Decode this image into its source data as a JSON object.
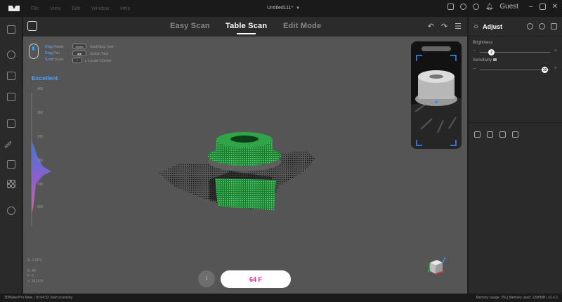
{
  "titlebar": {
    "menu": [
      "File",
      "View",
      "Edit",
      "Window",
      "Help"
    ],
    "document_title": "Untitled111*",
    "user": "Guest"
  },
  "modes": {
    "easy_scan": "Easy Scan",
    "table_scan": "Table Scan",
    "edit_mode": "Edit Mode",
    "active": "Table Scan"
  },
  "hints": {
    "rows": [
      {
        "key": "Drag",
        "value": "Rotate"
      },
      {
        "key": "Drag",
        "value": "Pan"
      },
      {
        "key": "Scroll",
        "value": "Scale"
      }
    ],
    "right": [
      {
        "key": "Space",
        "value": "Start/Stop Task"
      },
      {
        "key": "",
        "value": "Switch Task"
      },
      {
        "key": "",
        "value": "Locate 1Center"
      }
    ]
  },
  "quality": {
    "label": "Excellent",
    "ticks": [
      "400",
      "360",
      "320",
      "280",
      "240",
      "200"
    ]
  },
  "stats": {
    "fps": "11.2 FPS",
    "lines": [
      "D: 84",
      "F: 0",
      "V: 267478"
    ]
  },
  "scan": {
    "small_label": "1",
    "main_label": "64 F"
  },
  "adjust": {
    "title": "Adjust",
    "brightness_label": "Brightness",
    "brightness_value": "2",
    "sensitivity_label": "Sensitivity",
    "sensitivity_value": "10"
  },
  "statusbar": {
    "left": "3DMakerPro Mole | 18:04:33 Start scanning",
    "right": "Memory usage: 3% | Memory used: 1288MB | v2.6.2"
  },
  "colors": {
    "accent_blue": "#4fa3f7",
    "accent_pink": "#e0218a",
    "scan_green": "#2db34a",
    "viewport_bg": "#555556"
  }
}
